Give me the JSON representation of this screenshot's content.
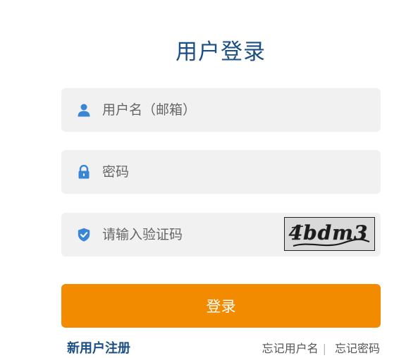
{
  "title": "用户登录",
  "username": {
    "placeholder": "用户名（邮箱）",
    "icon": "user-icon"
  },
  "password": {
    "placeholder": "密码",
    "icon": "lock-icon"
  },
  "captcha": {
    "placeholder": "请输入验证码",
    "icon": "shield-check-icon",
    "image_text": "4bdm3"
  },
  "login_button": "登录",
  "register_link": "新用户注册",
  "forgot_username": "忘记用户名",
  "separator": "|",
  "forgot_password": "忘记密码",
  "colors": {
    "brand": "#1b4f86",
    "accent": "#f28b00",
    "icon": "#3a86d6",
    "field_bg": "#f1f1f1"
  }
}
